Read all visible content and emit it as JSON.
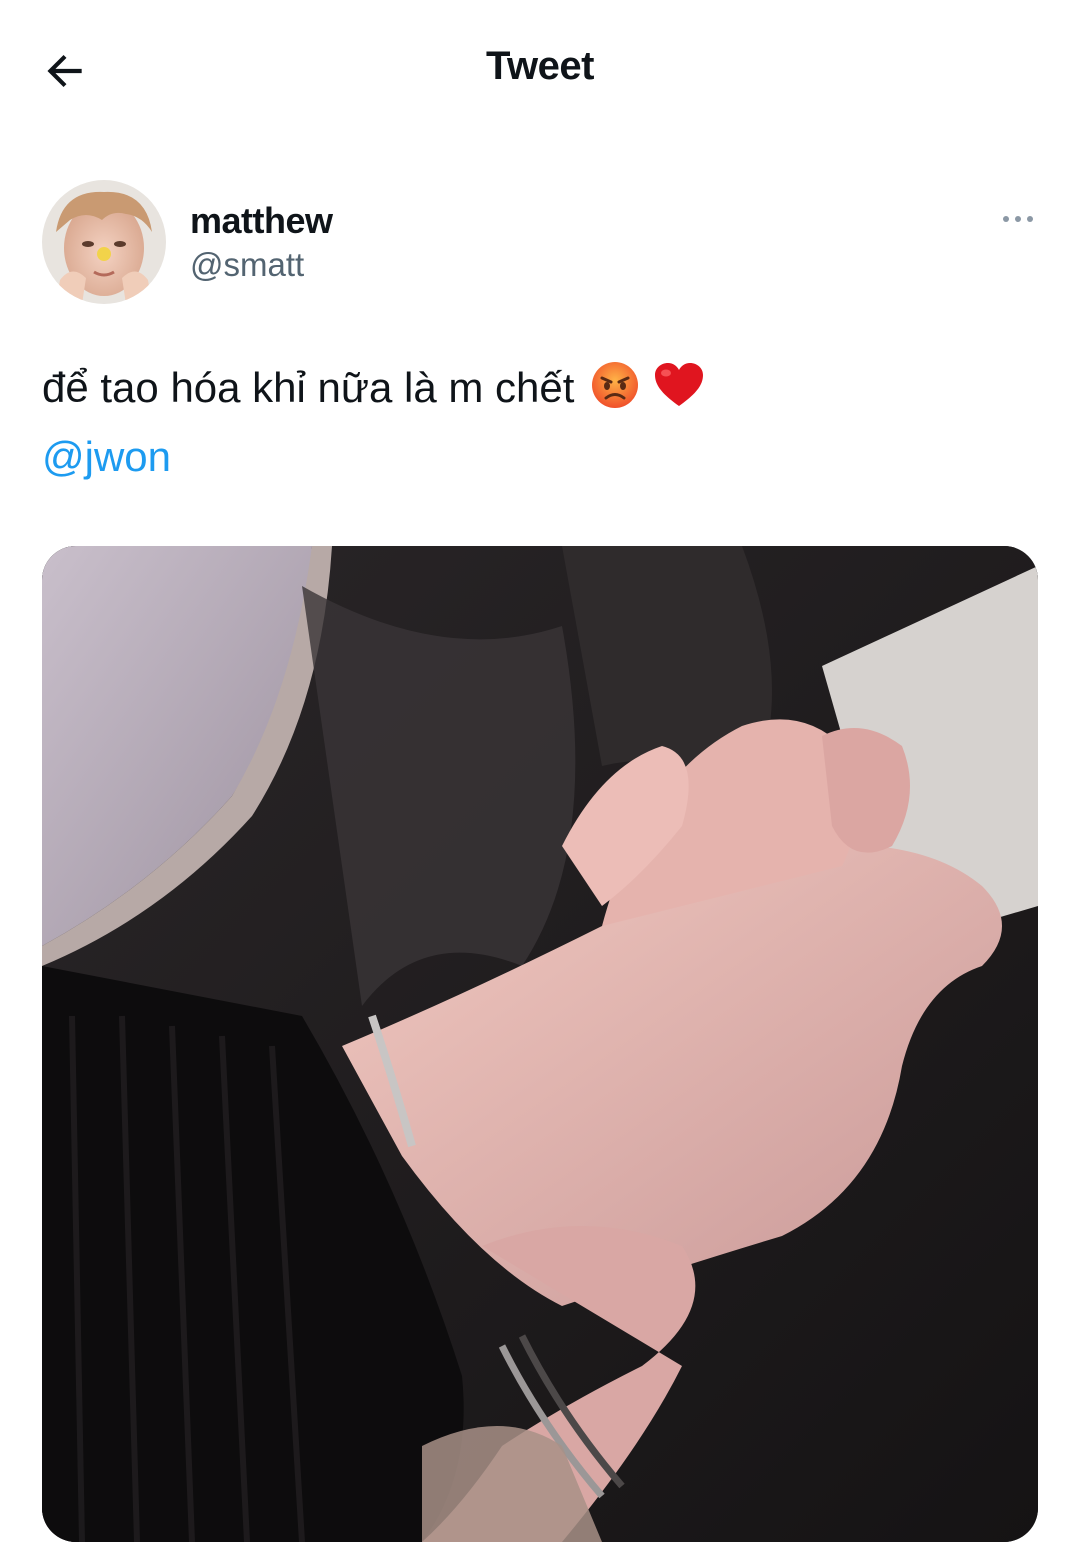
{
  "header": {
    "title": "Tweet",
    "back_icon": "arrow-left-icon"
  },
  "author": {
    "display_name": "matthew",
    "handle": "@smatt",
    "more_icon": "more-horizontal-icon"
  },
  "tweet": {
    "text": "để tao hóa khỉ nữa là m chết",
    "emojis": [
      "angry-face-emoji",
      "red-heart-emoji"
    ],
    "mention": "@jwon"
  },
  "colors": {
    "text": "#0f1419",
    "secondary": "#536471",
    "link": "#1d9bf0"
  }
}
